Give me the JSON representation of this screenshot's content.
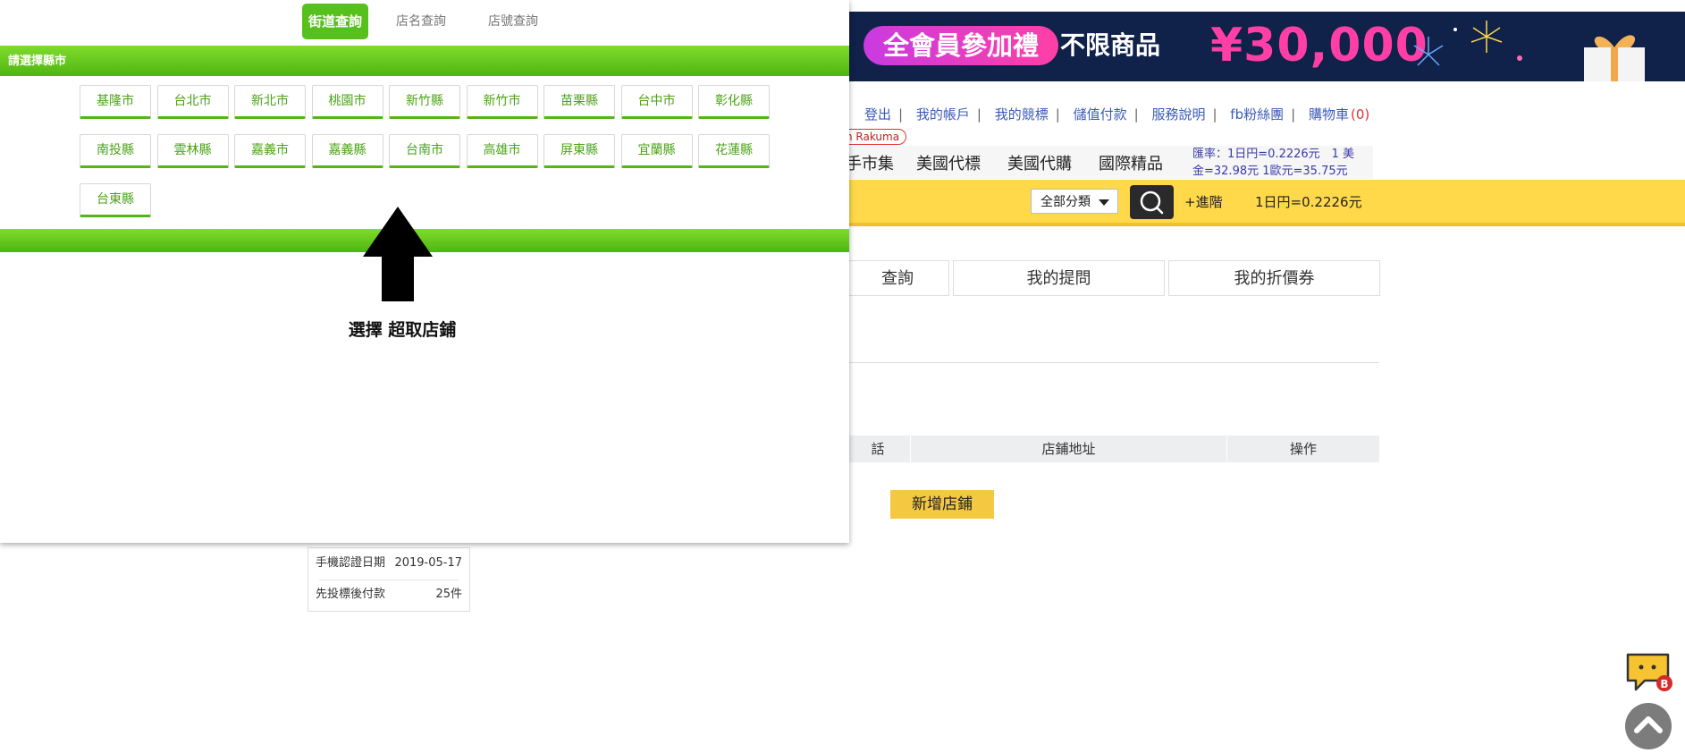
{
  "banner": {
    "pill_text": "全會員參加禮",
    "text_main": "不限商品",
    "amount": "¥30,000"
  },
  "toplinks": {
    "items": [
      "登出",
      "我的帳戶",
      "我的競標",
      "儲值付款",
      "服務說明",
      "fb粉絲團",
      "購物車"
    ],
    "cart_count": "(0)"
  },
  "rakuma_tag": "n Rakuma",
  "navbar": {
    "items": [
      "手市集",
      "美國代標",
      "美國代購",
      "國際精品"
    ],
    "rate_line1": "匯率：1日円=0.2226元　1 美",
    "rate_line2": "金=32.98元 1歐元=35.75元"
  },
  "search": {
    "category": "全部分類",
    "advanced": "+進階",
    "rate": "1日円=0.2226元"
  },
  "tabs": [
    "查詢",
    "我的提問",
    "我的折價券"
  ],
  "table_headers": [
    "話",
    "店鋪地址",
    "操作"
  ],
  "add_store_label": "新增店鋪",
  "infobox": {
    "rows": [
      {
        "label": "手機認證日期",
        "value": "2019-05-17"
      },
      {
        "label": "先投標後付款",
        "value": "25件"
      }
    ]
  },
  "popup": {
    "modes": [
      {
        "label": "街道查詢",
        "active": true
      },
      {
        "label": "店名查詢",
        "active": false
      },
      {
        "label": "店號查詢",
        "active": false
      }
    ],
    "city_header": "請選擇縣市",
    "cities": [
      "基隆市",
      "台北市",
      "新北市",
      "桃園市",
      "新竹縣",
      "新竹市",
      "苗栗縣",
      "台中市",
      "彰化縣",
      "南投縣",
      "雲林縣",
      "嘉義市",
      "嘉義縣",
      "台南市",
      "高雄市",
      "屏東縣",
      "宜蘭縣",
      "花蓮縣",
      "台東縣"
    ],
    "hint": "選擇 超取店鋪"
  },
  "colors": {
    "green": "#58c01d",
    "banner_bg": "#10214a",
    "banner_pink": "#ff3fa6",
    "search_yellow": "#ffd94a",
    "link_blue": "#3a5bb8"
  },
  "icons": [
    "search-icon",
    "chevron-down-icon",
    "chat-icon",
    "arrow-up-icon",
    "up-arrow-annotation-icon"
  ]
}
